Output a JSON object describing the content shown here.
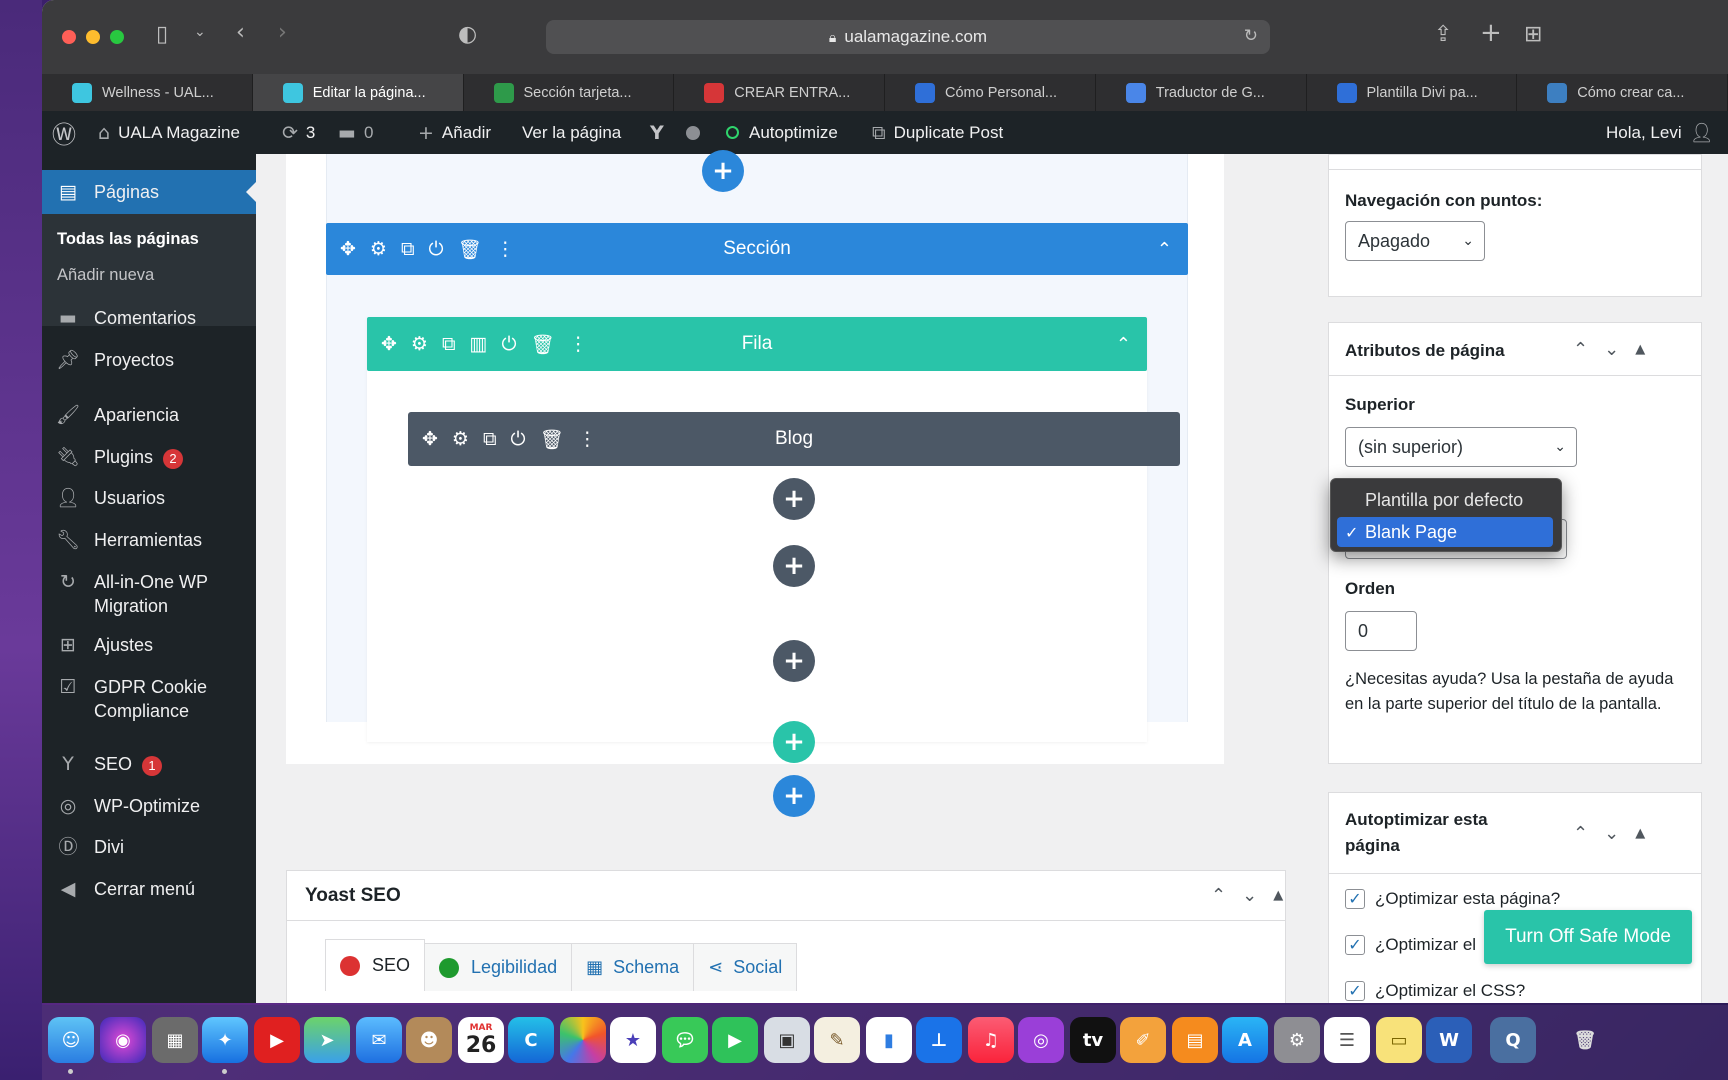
{
  "browser": {
    "url": "ualamagazine.com",
    "tabs": [
      {
        "label": "Wellness - UAL...",
        "color": "#3ec6e0"
      },
      {
        "label": "Editar la página...",
        "color": "#3ec6e0"
      },
      {
        "label": "Sección tarjeta...",
        "color": "#2e9a4a"
      },
      {
        "label": "CREAR ENTRA...",
        "color": "#d63638"
      },
      {
        "label": "Cómo Personal...",
        "color": "#2f6fd8"
      },
      {
        "label": "Traductor de G...",
        "color": "#4a86e8"
      },
      {
        "label": "Plantilla Divi pa...",
        "color": "#2f6fd8"
      },
      {
        "label": "Cómo crear ca...",
        "color": "#3d7fc1"
      }
    ]
  },
  "adminbar": {
    "site_name": "UALA Magazine",
    "updates_count": "3",
    "comments_count": "0",
    "add_label": "Añadir",
    "view_page": "Ver la página",
    "autoptimize": "Autoptimize",
    "duplicate_post": "Duplicate Post",
    "greeting": "Hola, Levi"
  },
  "sidebar": {
    "current": "Páginas",
    "submenu": {
      "all_pages": "Todas las páginas",
      "add_new": "Añadir nueva"
    },
    "items": [
      {
        "label": "Comentarios",
        "icon": "comment-icon"
      },
      {
        "label": "Proyectos",
        "icon": "pin-icon"
      },
      {
        "label": "Apariencia",
        "icon": "brush-icon"
      },
      {
        "label": "Plugins",
        "icon": "plug-icon",
        "badge": "2"
      },
      {
        "label": "Usuarios",
        "icon": "user-icon"
      },
      {
        "label": "Herramientas",
        "icon": "wrench-icon"
      },
      {
        "label": "All-in-One WP",
        "label2": "Migration",
        "icon": "migration-icon"
      },
      {
        "label": "Ajustes",
        "icon": "settings-icon"
      },
      {
        "label": "GDPR Cookie",
        "label2": "Compliance",
        "icon": "checkbox-icon"
      },
      {
        "label": "SEO",
        "icon": "yoast-icon",
        "badge": "1"
      },
      {
        "label": "WP-Optimize",
        "icon": "optimize-icon"
      },
      {
        "label": "Divi",
        "icon": "divi-icon"
      },
      {
        "label": "Cerrar menú",
        "icon": "collapse-icon"
      }
    ]
  },
  "builder": {
    "section_label": "Sección",
    "row_label": "Fila",
    "module_label": "Blog",
    "section_color": "#2b87da",
    "row_color": "#29c4a9",
    "module_color": "#4c5866"
  },
  "yoast": {
    "title": "Yoast SEO",
    "tabs": [
      {
        "label": "SEO",
        "icon": "red-dot-icon"
      },
      {
        "label": "Legibilidad",
        "icon": "smiley-icon"
      },
      {
        "label": "Schema",
        "icon": "grid-icon"
      },
      {
        "label": "Social",
        "icon": "share-icon"
      }
    ]
  },
  "right": {
    "dots_nav_label": "Navegación con puntos:",
    "dots_nav_value": "Apagado",
    "page_attrs_title": "Atributos de página",
    "parent_label": "Superior",
    "parent_value": "(sin superior)",
    "template_options": [
      "Plantilla por defecto",
      "Blank Page"
    ],
    "template_selected": "Blank Page",
    "order_label": "Orden",
    "order_value": "0",
    "help_text": "¿Necesitas ayuda? Usa la pestaña de ayuda en la parte superior del título de la pantalla.",
    "autoptimize_title_1": "Autoptimizar esta",
    "autoptimize_title_2": "página",
    "checkboxes": [
      "¿Optimizar esta página?",
      "¿Optimizar el",
      "¿Optimizar el CSS?"
    ],
    "safe_mode_button": "Turn Off Safe Mode"
  },
  "dock": {
    "calendar_month": "MAR",
    "calendar_day": "26"
  }
}
